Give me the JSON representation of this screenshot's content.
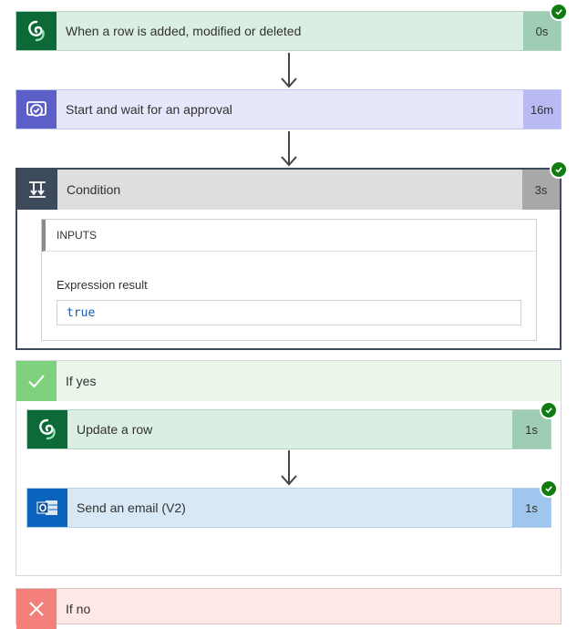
{
  "steps": [
    {
      "title": "When a row is added, modified or deleted",
      "duration": "0s",
      "icon": "dataverse-icon"
    },
    {
      "title": "Start and wait for an approval",
      "duration": "16m",
      "icon": "approval-icon"
    }
  ],
  "condition": {
    "title": "Condition",
    "duration": "3s",
    "icon": "condition-icon",
    "inputs_label": "INPUTS",
    "expression_label": "Expression result",
    "expression_value": "true"
  },
  "if_yes": {
    "label": "If yes",
    "actions": [
      {
        "title": "Update a row",
        "duration": "1s",
        "icon": "dataverse-icon"
      },
      {
        "title": "Send an email (V2)",
        "duration": "1s",
        "icon": "outlook-icon"
      }
    ]
  },
  "if_no": {
    "label": "If no"
  },
  "colors": {
    "dataverse": "#0b6a38",
    "approval": "#5b5fc7",
    "outlook": "#0a64bd",
    "success": "#107c10",
    "yes_green": "#7fd17f",
    "no_red": "#f4807b"
  }
}
